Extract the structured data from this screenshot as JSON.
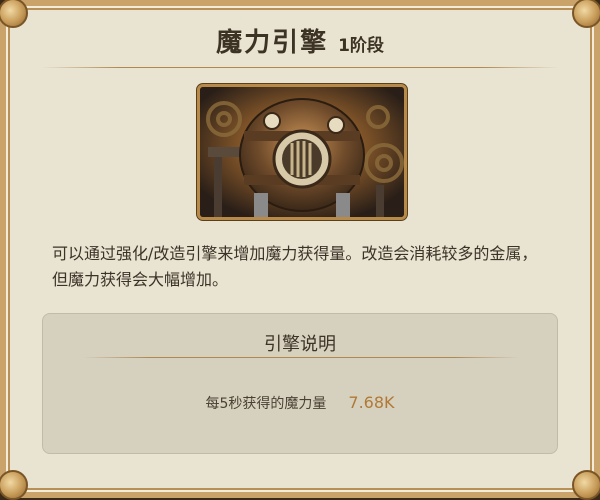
{
  "dialog": {
    "title": "魔力引擎",
    "stage": "1阶段",
    "description": "可以通过强化/改造引擎来增加魔力获得量。改造会消耗较多的金属，但魔力获得会大幅增加。"
  },
  "engine_panel": {
    "title": "引擎说明",
    "stat_label": "每5秒获得的魔力量",
    "stat_value": "7.68K"
  },
  "colors": {
    "accent_gold": "#b07a36",
    "frame_gold": "#c9a36a",
    "background": "#e9e3d1",
    "panel": "#d6d0bf"
  },
  "icons": {
    "artwork": "magic-engine-illustration"
  }
}
